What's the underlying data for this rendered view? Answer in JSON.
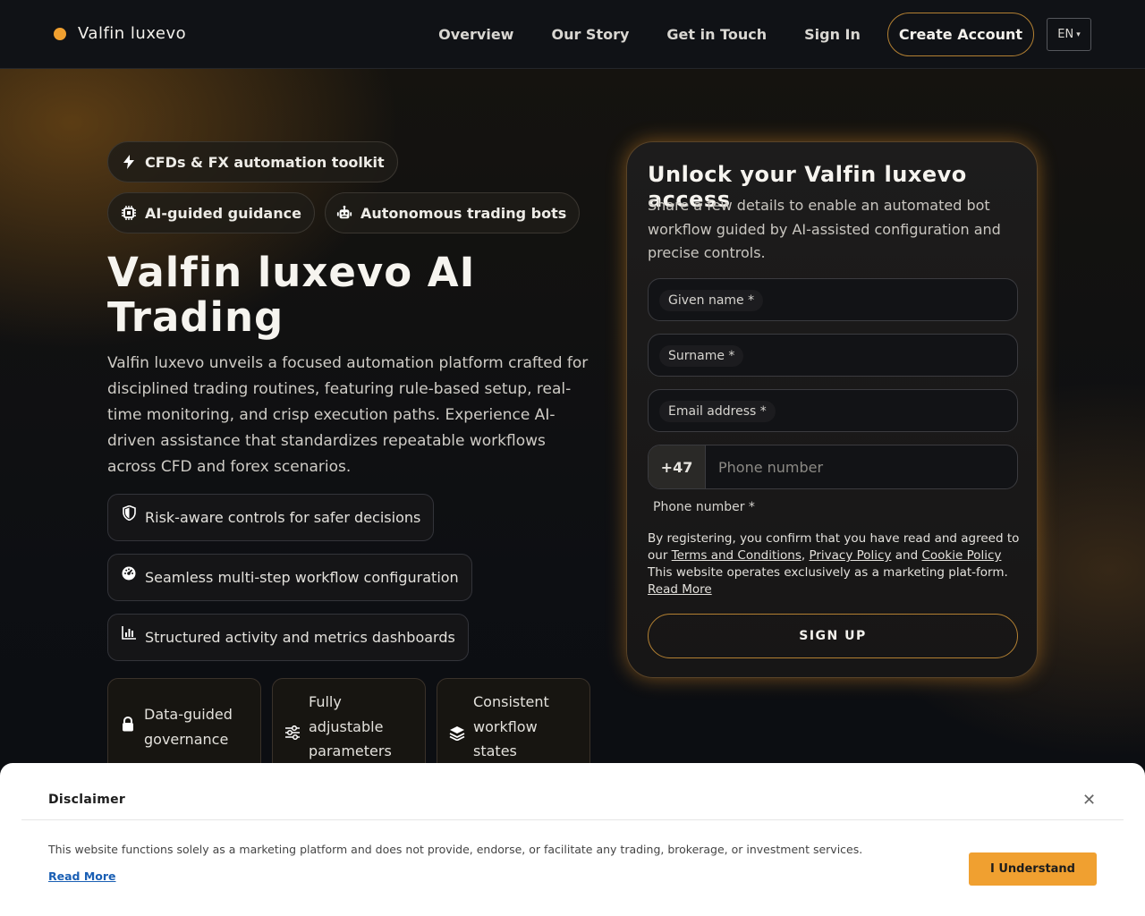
{
  "brand": {
    "name": "Valfin luxevo",
    "accent": "#f0a030"
  },
  "nav": {
    "items": [
      "Overview",
      "Our Story",
      "Get in Touch",
      "Sign In"
    ],
    "create_account": "Create Account",
    "language": "EN"
  },
  "hero": {
    "pills": [
      {
        "icon": "bolt-icon",
        "label": "CFDs & FX automation toolkit"
      },
      {
        "icon": "chip-icon",
        "label": "AI-guided guidance"
      },
      {
        "icon": "robot-icon",
        "label": "Autonomous trading bots"
      }
    ],
    "title": "Valfin luxevo AI Trading",
    "description": "Valfin luxevo unveils a focused automation platform crafted for disciplined trading routines, featuring rule-based setup, real-time monitoring, and crisp execution paths. Experience AI-driven assistance that standardizes repeatable workflows across CFD and forex scenarios.",
    "features": [
      {
        "icon": "shield-icon",
        "label": "Risk-aware controls for safer decisions"
      },
      {
        "icon": "gauge-icon",
        "label": "Seamless multi-step workflow configuration"
      },
      {
        "icon": "bar-chart-icon",
        "label": "Structured activity and metrics dashboards"
      }
    ],
    "cards": [
      {
        "icon": "lock-icon",
        "label": "Data-guided governance"
      },
      {
        "icon": "sliders-icon",
        "label": "Fully adjustable parameters"
      },
      {
        "icon": "layers-icon",
        "label": "Consistent workflow states"
      }
    ]
  },
  "form": {
    "title": "Unlock your Valfin luxevo access",
    "description": "Share a few details to enable an automated bot workflow guided by AI-assisted configuration and precise controls.",
    "given_name": "Given name *",
    "surname": "Surname *",
    "email": "Email address *",
    "phone_code": "+47",
    "phone_placeholder": "Phone number",
    "phone_label": "Phone number *",
    "consent_prefix": "By registering, you confirm that you have read and agreed to our",
    "terms": "Terms and Conditions",
    "privacy": "Privacy Policy",
    "and": "and",
    "cookie": "Cookie Policy",
    "consent_suffix": "This website operates exclusively as a marketing plat-form.",
    "read_more": "Read More",
    "signup": "SIGN UP"
  },
  "disclaimer": {
    "title": "Disclaimer",
    "text": "This website functions solely as a marketing platform and does not provide, endorse, or facilitate any trading, brokerage, or investment services.",
    "read_more": "Read More",
    "button": "I Understand"
  }
}
